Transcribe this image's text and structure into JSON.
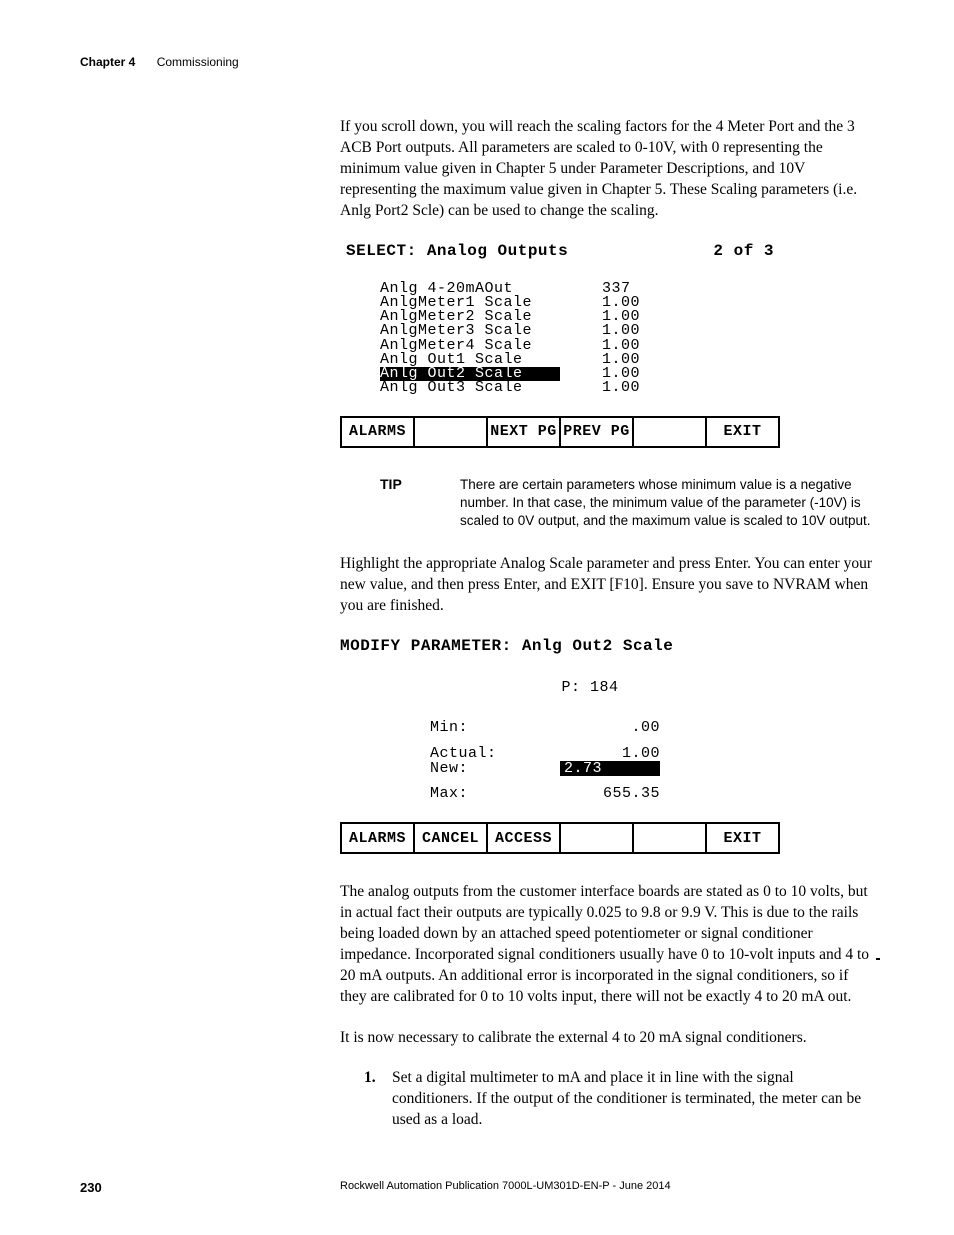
{
  "header": {
    "chapter_label": "Chapter 4",
    "chapter_title": "Commissioning"
  },
  "para1": "If you scroll down, you will reach the scaling factors for the 4 Meter Port and the 3 ACB Port outputs. All parameters are scaled to 0-10V, with 0 representing the minimum value given in Chapter 5 under Parameter Descriptions, and 10V representing the maximum value given in Chapter 5. These Scaling parameters (i.e. Anlg Port2 Scle) can be used to change the scaling.",
  "hmi1": {
    "title_left": "SELECT: Analog Outputs",
    "title_right": "2 of  3",
    "rows": [
      {
        "label": "Anlg 4-20mAOut",
        "value": "337 "
      },
      {
        "label": "AnlgMeter1 Scale",
        "value": "1.00"
      },
      {
        "label": "AnlgMeter2 Scale",
        "value": "1.00"
      },
      {
        "label": "AnlgMeter3 Scale",
        "value": "1.00"
      },
      {
        "label": "AnlgMeter4 Scale",
        "value": "1.00"
      },
      {
        "label": "Anlg Out1 Scale",
        "value": "1.00"
      },
      {
        "label": "Anlg Out2 Scale",
        "value": "1.00",
        "hl": true
      },
      {
        "label": "Anlg Out3 Scale",
        "value": "1.00"
      }
    ],
    "fkeys": [
      "ALARMS",
      "",
      "NEXT PG",
      "PREV PG",
      "",
      "EXIT"
    ]
  },
  "tip": {
    "label": "TIP",
    "text": "There are certain parameters whose minimum value is a negative number. In that case, the minimum value of the parameter (-10V) is scaled to 0V output, and the maximum value is scaled to 10V output."
  },
  "para2": "Highlight the appropriate Analog Scale parameter and press Enter. You can enter your new value, and then press Enter, and EXIT [F10]. Ensure you save to NVRAM when you are finished.",
  "hmi2": {
    "title": "MODIFY PARAMETER: Anlg Out2 Scale",
    "p_line": "P: 184",
    "min_label": "Min:",
    "min_value": ".00",
    "actual_label": "Actual:",
    "actual_value": "1.00",
    "new_label": "New:",
    "new_value": "2.73",
    "max_label": "Max:",
    "max_value": "655.35",
    "fkeys": [
      "ALARMS",
      "CANCEL",
      "ACCESS",
      "",
      "",
      "EXIT"
    ]
  },
  "para3": "The analog outputs from the customer interface boards are stated as 0 to 10 volts, but in actual fact their outputs are typically 0.025 to 9.8 or 9.9 V. This is due to the rails being loaded down by an attached speed potentiometer or signal conditioner impedance. Incorporated signal conditioners usually have 0 to 10-volt inputs and 4 to 20 mA outputs. An additional error is incorporated in the signal conditioners, so if they are calibrated for 0 to 10 volts input, there will not be exactly 4 to 20 mA out.",
  "para4": "It is now necessary to calibrate the external 4 to 20 mA signal conditioners.",
  "step1_num": "1.",
  "step1_text": "Set a digital multimeter to mA and place it in line with the signal conditioners. If the output of the conditioner is terminated, the meter can be used as a load.",
  "footer": {
    "page": "230",
    "pub": "Rockwell Automation Publication 7000L-UM301D-EN-P - June 2014"
  }
}
